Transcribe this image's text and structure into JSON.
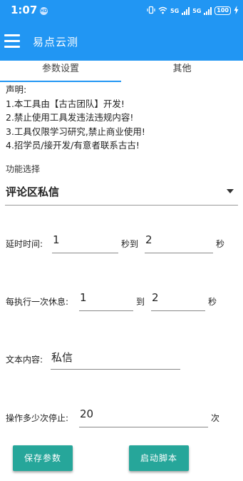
{
  "status_bar": {
    "time": "1:07",
    "hd_badge": "HD",
    "signal_label_1": "5G",
    "signal_label_2": "5G",
    "battery": "100",
    "icons": [
      "vibrate-icon",
      "wifi-icon",
      "signal-icon",
      "battery-icon",
      "charging-icon"
    ]
  },
  "app_bar": {
    "title": "易点云测",
    "menu_icon": "hamburger-menu-icon"
  },
  "tabs": [
    {
      "label": "参数设置",
      "selected": true
    },
    {
      "label": "其他",
      "selected": false
    }
  ],
  "declaration": {
    "heading": "声明:",
    "lines": [
      "1.本工具由【古古团队】开发!",
      "2.禁止使用工具发违法违规内容!",
      "3.工具仅限学习研究,禁止商业使用!",
      "4.招学员/接开发/有意者联系古古!"
    ]
  },
  "function_select": {
    "label": "功能选择",
    "value": "评论区私信"
  },
  "delay": {
    "label": "延时时间:",
    "from": "1",
    "to_label": "秒到",
    "to": "2",
    "unit": "秒"
  },
  "rest": {
    "label": "每执行一次休息:",
    "from": "1",
    "to_label": "到",
    "to": "2",
    "unit": "秒"
  },
  "content": {
    "label": "文本内容:",
    "value": "私信"
  },
  "stop_after": {
    "label": "操作多少次停止:",
    "value": "20",
    "unit": "次"
  },
  "buttons": {
    "save": "保存参数",
    "start": "启动脚本"
  },
  "colors": {
    "primary": "#2196F3",
    "button": "#26A69A"
  }
}
